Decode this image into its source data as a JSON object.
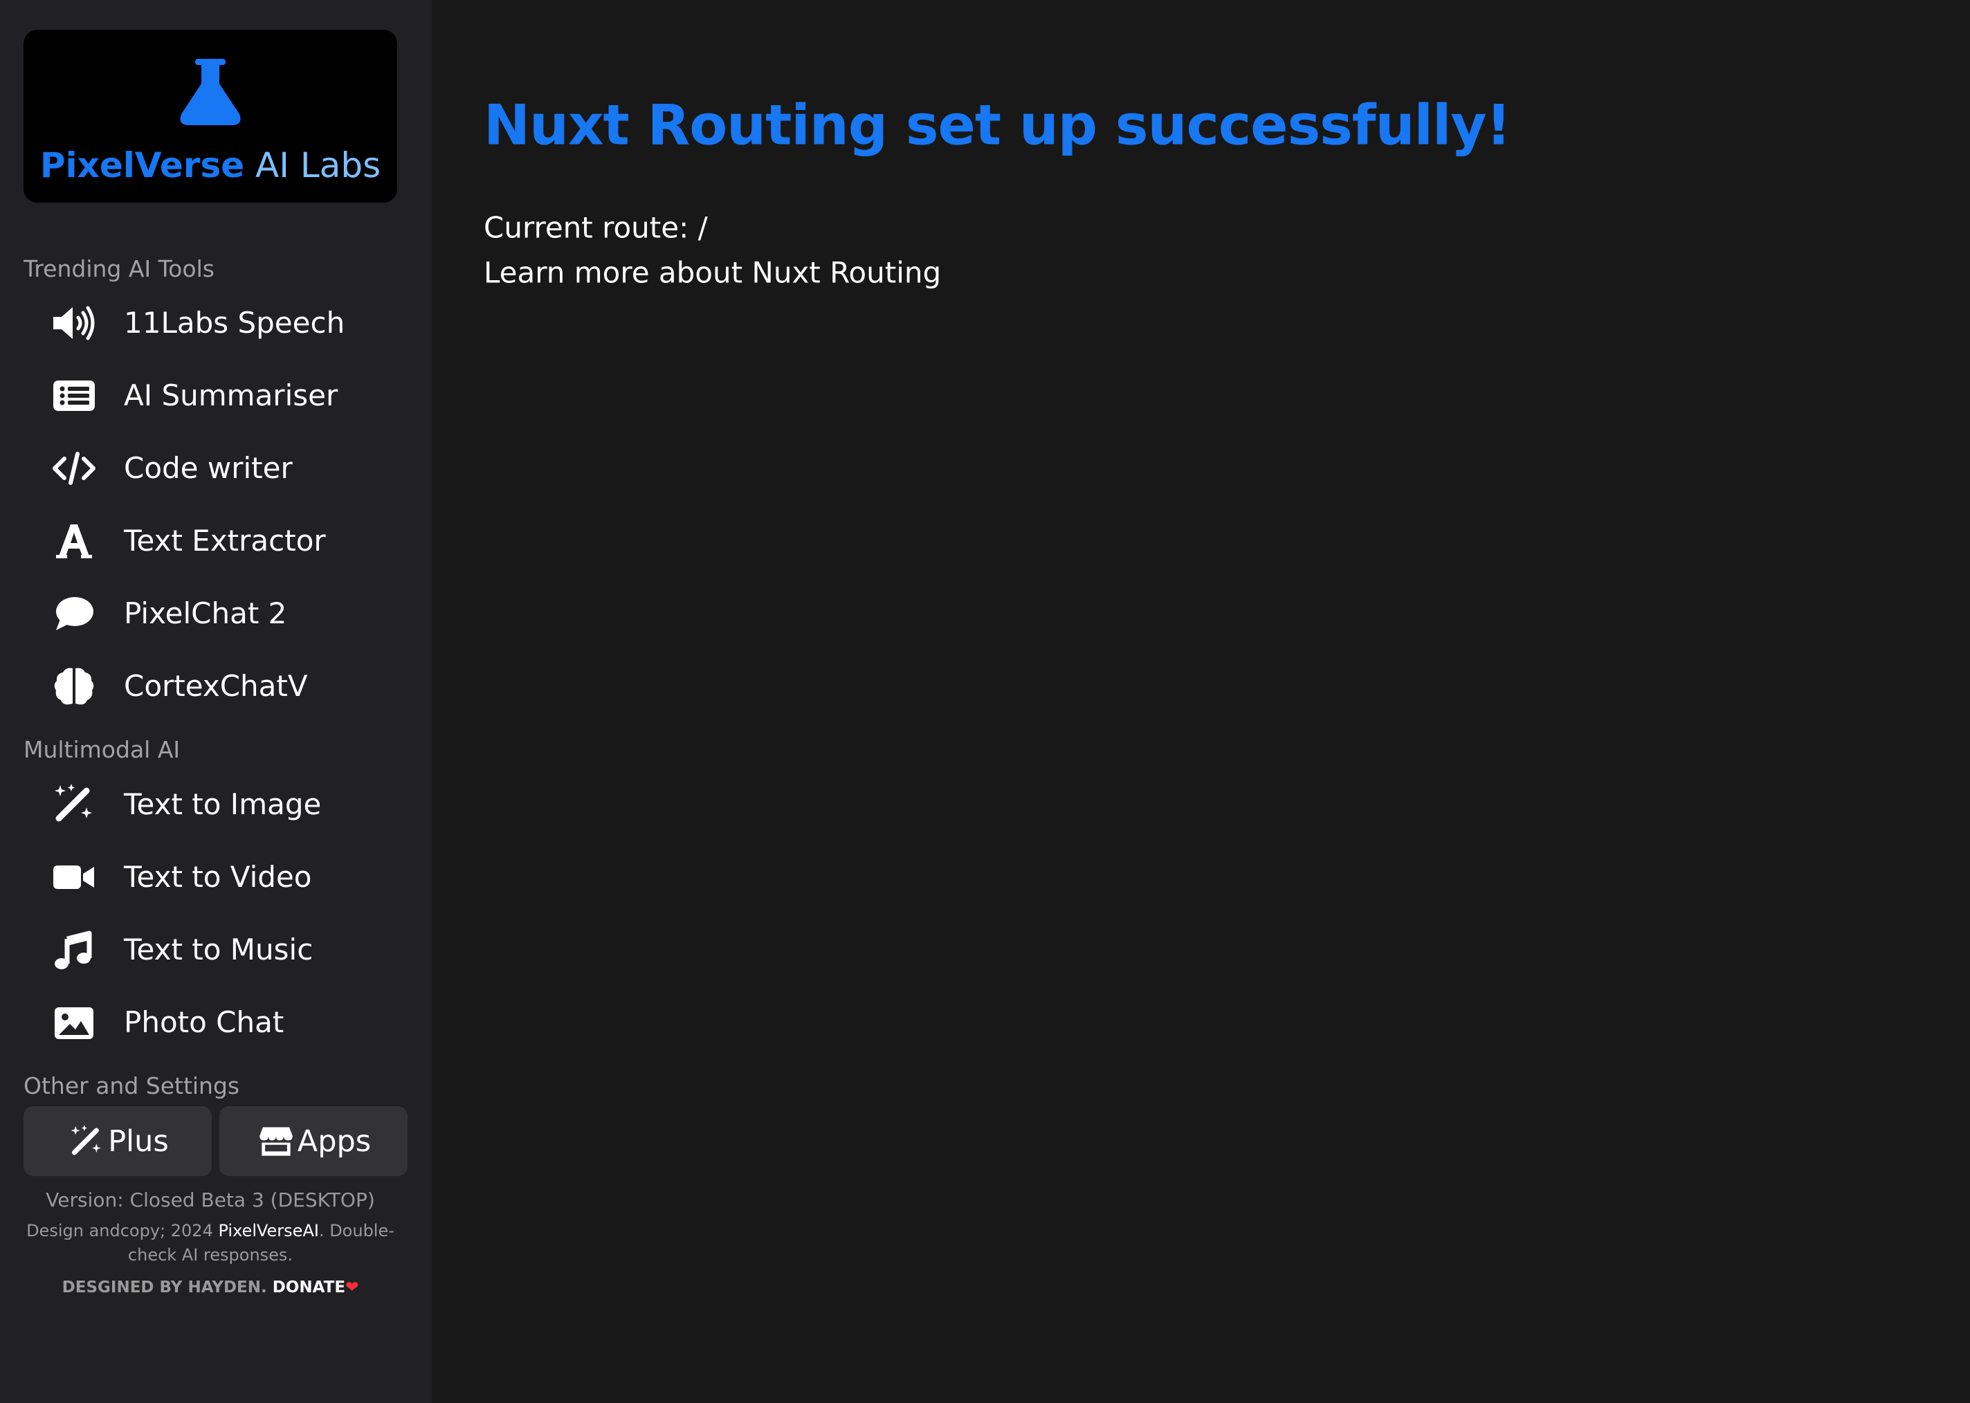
{
  "brand": {
    "name": "PixelVerse",
    "suffix": " AI Labs"
  },
  "sidebar": {
    "sections": {
      "trending": "Trending AI Tools",
      "multimodal": "Multimodal AI",
      "other": "Other and Settings"
    },
    "trending_items": [
      {
        "label": "11Labs Speech",
        "icon": "volume-icon"
      },
      {
        "label": "AI Summariser",
        "icon": "list-icon"
      },
      {
        "label": "Code writer",
        "icon": "code-icon"
      },
      {
        "label": "Text Extractor",
        "icon": "font-icon"
      },
      {
        "label": "PixelChat 2",
        "icon": "chat-bubble-icon"
      },
      {
        "label": "CortexChatV",
        "icon": "brain-icon"
      }
    ],
    "multimodal_items": [
      {
        "label": "Text to Image",
        "icon": "magic-wand-icon"
      },
      {
        "label": "Text to Video",
        "icon": "video-camera-icon"
      },
      {
        "label": "Text to Music",
        "icon": "music-note-icon"
      },
      {
        "label": "Photo Chat",
        "icon": "image-icon"
      }
    ],
    "buttons": {
      "plus": "Plus",
      "apps": "Apps"
    },
    "footer": {
      "version": "Version: Closed Beta 3 (DESKTOP)",
      "copyright_prefix": "Design andcopy; 2024 ",
      "copyright_link": "PixelVerseAI",
      "copyright_suffix": ". Double-check AI responses.",
      "credits": "DESGINED BY HAYDEN. ",
      "donate": "DONATE",
      "heart": "❤"
    }
  },
  "main": {
    "title": "Nuxt Routing set up successfully!",
    "current_route": "Current route: /",
    "learn_more": "Learn more about Nuxt Routing"
  },
  "colors": {
    "background": "#181818",
    "sidebar": "#212123",
    "accent": "#1877f2",
    "accent_light": "#7fbfff"
  }
}
